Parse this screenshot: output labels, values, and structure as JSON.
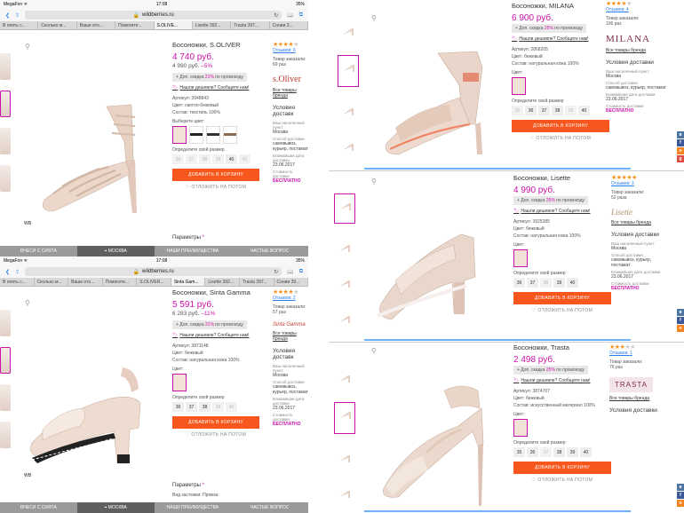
{
  "browser": {
    "status_left": "MegaFon ᯤ",
    "time": "17:08",
    "battery": "35",
    "url": "wildberries.ru",
    "tabs_top": [
      "В опять с...",
      "Сколько м...",
      "Ваше ото...",
      "Помогите...",
      "S.OLIVE...",
      "Lisette 392...",
      "Trasta 397...",
      "Сонии 3..."
    ],
    "tabs_bottom": [
      "В опять с...",
      "Сколько м...",
      "Ваше ото...",
      "Помогите...",
      "S.OLIVER...",
      "Sinta Gam...",
      "Lisette 392...",
      "Trasta 397...",
      "Сонии 39..."
    ],
    "bottom_left": "ВНЕСИ С СИЯТА",
    "bottom_city": "МОСКВА",
    "bottom_mid2": "НАШИ ПРЕИМУЩЕСТВА",
    "bottom_right": "ЧАСТЫЕ ВОПРОС"
  },
  "common": {
    "discount_prefix": "+ Доп. скидка",
    "discount_suffix": "по промокоду",
    "cheaper": "Нашли дешевле? Сообщите нам!",
    "article_label": "Артикул:",
    "color_label": "Цвет:",
    "composition_label": "Состав:",
    "choose_color": "Выберите цвет:",
    "size_label": "Определите свой размер",
    "add_to_cart": "ДОБАВИТЬ В КОРЗИНУ",
    "save_later": "ОТЛОЖИТЬ НА ПОТОМ",
    "params": "Параметры",
    "wb": "WB",
    "reviews_prefix": "Отзывов:",
    "orders_label": "Товар заказали:",
    "brand_all": "Все товары бренда",
    "delivery_title": "Условия доставки",
    "delivery_title_cut": "Условия доставк",
    "location_label": "Ваш населенный пункт:",
    "location_value": "Москва",
    "method_label": "Способ доставки",
    "method_value": "самовывоз, курьер, постамат",
    "date_label": "Ближайшая дата доставки",
    "date_value": "23.06.2017",
    "cost_label": "Стоимость доставки",
    "cost_value": "БЕСПЛАТНО"
  },
  "p1": {
    "title": "Босоножки, S.OLIVER",
    "price": "4 740 руб.",
    "old_price": "4 990 руб.",
    "pct": "–5%",
    "promo": "21%",
    "article": "3948843",
    "color": "светло-бежевый",
    "composition": "текстиль 100%",
    "sizes": [
      "36",
      "37",
      "38",
      "39",
      "40",
      "41"
    ],
    "reviews": "6",
    "stars": 4,
    "orders": "69 раз",
    "brand": "s.Oliver"
  },
  "p2": {
    "title": "Босоножки, Sinta Gamma",
    "price": "5 591 руб.",
    "old_price": "6 283 руб.",
    "pct": "–11%",
    "promo": "31%",
    "article": "3871148",
    "color": "бежевый",
    "composition": "натуральная кожа 100%",
    "sizes": [
      "36",
      "37",
      "38",
      "39",
      "40"
    ],
    "reviews": "2",
    "stars": 4,
    "orders": "57 раз",
    "brand": "Sinta Gamma",
    "param1_label": "Вид застежки:",
    "param1_value": "Пряжка"
  },
  "p3": {
    "title": "Босоножки, MILANA",
    "price": "6 900 руб.",
    "promo": "25%",
    "article": "2868205",
    "color": "бежевый",
    "composition": "натуральная кожа 100%",
    "sizes": [
      "35",
      "36",
      "37",
      "38",
      "39",
      "40"
    ],
    "reviews": "4",
    "stars": 4,
    "orders": "106 раз",
    "brand": "MILANA"
  },
  "p4": {
    "title": "Босоножки, Lisette",
    "price": "4 990 руб.",
    "promo": "25%",
    "article": "3925385",
    "color": "бежевый",
    "composition": "натуральная кожа 100%",
    "sizes": [
      "36",
      "37",
      "38",
      "39",
      "40"
    ],
    "reviews": "3",
    "stars": 5,
    "orders": "52 раза",
    "brand": "Lisette"
  },
  "p5": {
    "title": "Босоножки, Trasta",
    "price": "2 498 руб.",
    "promo": "25%",
    "article": "3874707",
    "color": "бежевый",
    "composition": "искусственный материал 100%",
    "sizes": [
      "35",
      "36",
      "37",
      "38",
      "39",
      "40"
    ],
    "reviews": "1",
    "stars": 3,
    "orders": "76 раз",
    "brand": "TRASTA"
  },
  "colors": {
    "accent": "#cb11ab",
    "button": "#f7571c",
    "link": "#2b7de9",
    "star": "#f7931e"
  }
}
